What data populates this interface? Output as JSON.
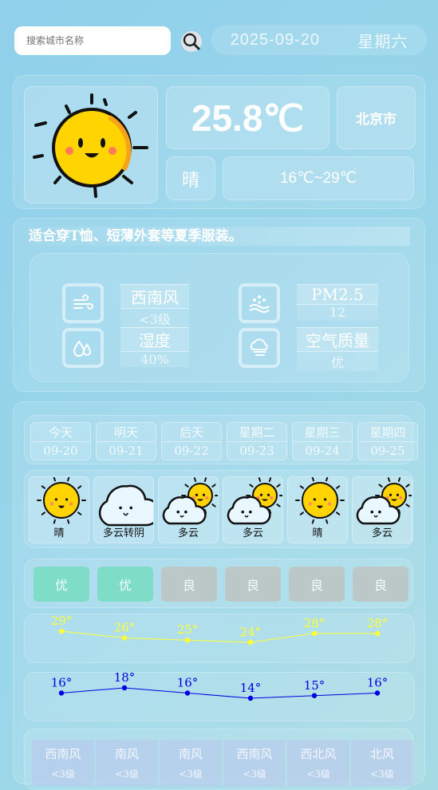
{
  "search": {
    "placeholder": "搜索城市名称"
  },
  "header": {
    "date": "2025-09-20",
    "weekday": "星期六"
  },
  "current": {
    "temperature": "25.8℃",
    "city": "北京市",
    "condition": "晴",
    "range": "16℃~29℃",
    "icon": "sun-icon"
  },
  "advice": "适合穿T恤、短薄外套等夏季服装。",
  "details": {
    "wind_dir": "西南风",
    "wind_level": "<3级",
    "humidity_label": "湿度",
    "humidity": "40%",
    "pm_label": "PM2.5",
    "pm_value": "12",
    "aq_label": "空气质量",
    "aq_value": "优"
  },
  "forecast": [
    {
      "day": "今天",
      "date": "09-20",
      "weather": "晴",
      "icon": "sun",
      "aqi": "优",
      "high": 29,
      "low": 16,
      "wind": "西南风",
      "wind_level": "<3级"
    },
    {
      "day": "明天",
      "date": "09-21",
      "weather": "多云转阴",
      "icon": "cloud",
      "aqi": "优",
      "high": 26,
      "low": 18,
      "wind": "南风",
      "wind_level": "<3级"
    },
    {
      "day": "后天",
      "date": "09-22",
      "weather": "多云",
      "icon": "partly",
      "aqi": "良",
      "high": 25,
      "low": 16,
      "wind": "南风",
      "wind_level": "<3级"
    },
    {
      "day": "星期二",
      "date": "09-23",
      "weather": "多云",
      "icon": "partly",
      "aqi": "良",
      "high": 24,
      "low": 14,
      "wind": "西南风",
      "wind_level": "<3级"
    },
    {
      "day": "星期三",
      "date": "09-24",
      "weather": "晴",
      "icon": "sun",
      "aqi": "良",
      "high": 28,
      "low": 15,
      "wind": "西北风",
      "wind_level": "<3级"
    },
    {
      "day": "星期四",
      "date": "09-25",
      "weather": "多云",
      "icon": "partly",
      "aqi": "良",
      "high": 28,
      "low": 16,
      "wind": "北风",
      "wind_level": "<3级"
    }
  ],
  "colors": {
    "aqi_good": "#7fdcc6",
    "aqi_fair": "#bcc8c8",
    "high_line": "#ffff33",
    "low_line": "#0000e0"
  },
  "units": {
    "degree": "°"
  }
}
